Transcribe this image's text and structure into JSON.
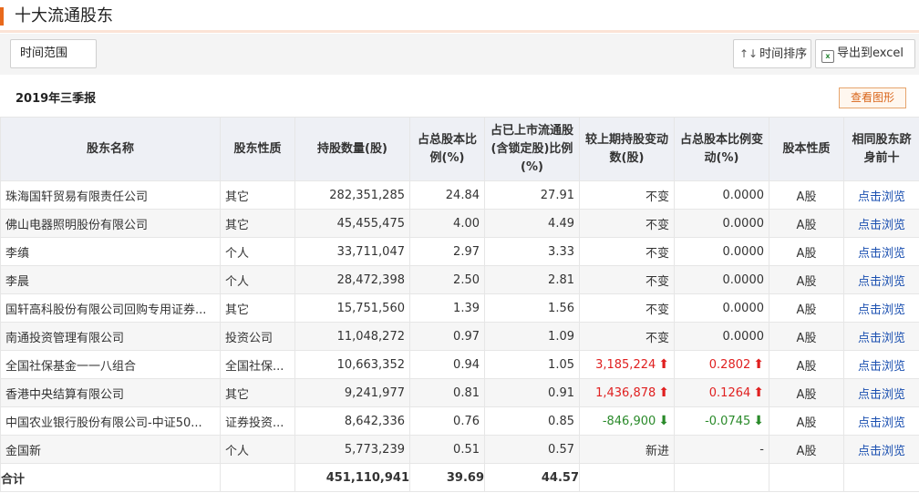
{
  "page_title": "十大流通股东",
  "filter": {
    "time_range_label": "时间范围"
  },
  "toolbar": {
    "sort_label": "时间排序",
    "export_label": "导出到excel"
  },
  "period": "2019年三季报",
  "view_chart_label": "查看图形",
  "columns": [
    "股东名称",
    "股东性质",
    "持股数量(股)",
    "占总股本比例(%)",
    "占已上市流通股(含锁定股)比例(%)",
    "较上期持股变动数(股)",
    "占总股本比例变动(%)",
    "股本性质",
    "相同股东跻身前十"
  ],
  "rows": [
    {
      "name": "珠海国轩贸易有限责任公司",
      "type": "其它",
      "shares": "282,351,285",
      "pct_total": "24.84",
      "pct_float": "27.91",
      "change": "不变",
      "change_dir": "none",
      "pct_change": "0.0000",
      "pct_change_dir": "none",
      "share_type": "A股",
      "link": "点击浏览"
    },
    {
      "name": "佛山电器照明股份有限公司",
      "type": "其它",
      "shares": "45,455,475",
      "pct_total": "4.00",
      "pct_float": "4.49",
      "change": "不变",
      "change_dir": "none",
      "pct_change": "0.0000",
      "pct_change_dir": "none",
      "share_type": "A股",
      "link": "点击浏览"
    },
    {
      "name": "李缜",
      "type": "个人",
      "shares": "33,711,047",
      "pct_total": "2.97",
      "pct_float": "3.33",
      "change": "不变",
      "change_dir": "none",
      "pct_change": "0.0000",
      "pct_change_dir": "none",
      "share_type": "A股",
      "link": "点击浏览"
    },
    {
      "name": "李晨",
      "type": "个人",
      "shares": "28,472,398",
      "pct_total": "2.50",
      "pct_float": "2.81",
      "change": "不变",
      "change_dir": "none",
      "pct_change": "0.0000",
      "pct_change_dir": "none",
      "share_type": "A股",
      "link": "点击浏览"
    },
    {
      "name": "国轩高科股份有限公司回购专用证券...",
      "type": "其它",
      "shares": "15,751,560",
      "pct_total": "1.39",
      "pct_float": "1.56",
      "change": "不变",
      "change_dir": "none",
      "pct_change": "0.0000",
      "pct_change_dir": "none",
      "share_type": "A股",
      "link": "点击浏览"
    },
    {
      "name": "南通投资管理有限公司",
      "type": "投资公司",
      "shares": "11,048,272",
      "pct_total": "0.97",
      "pct_float": "1.09",
      "change": "不变",
      "change_dir": "none",
      "pct_change": "0.0000",
      "pct_change_dir": "none",
      "share_type": "A股",
      "link": "点击浏览"
    },
    {
      "name": "全国社保基金一一八组合",
      "type": "全国社保...",
      "shares": "10,663,352",
      "pct_total": "0.94",
      "pct_float": "1.05",
      "change": "3,185,224",
      "change_dir": "up",
      "pct_change": "0.2802",
      "pct_change_dir": "up",
      "share_type": "A股",
      "link": "点击浏览"
    },
    {
      "name": "香港中央结算有限公司",
      "type": "其它",
      "shares": "9,241,977",
      "pct_total": "0.81",
      "pct_float": "0.91",
      "change": "1,436,878",
      "change_dir": "up",
      "pct_change": "0.1264",
      "pct_change_dir": "up",
      "share_type": "A股",
      "link": "点击浏览"
    },
    {
      "name": "中国农业银行股份有限公司-中证50...",
      "type": "证券投资...",
      "shares": "8,642,336",
      "pct_total": "0.76",
      "pct_float": "0.85",
      "change": "-846,900",
      "change_dir": "down",
      "pct_change": "-0.0745",
      "pct_change_dir": "down",
      "share_type": "A股",
      "link": "点击浏览"
    },
    {
      "name": "金国新",
      "type": "个人",
      "shares": "5,773,239",
      "pct_total": "0.51",
      "pct_float": "0.57",
      "change": "新进",
      "change_dir": "none",
      "pct_change": "-",
      "pct_change_dir": "none",
      "share_type": "A股",
      "link": "点击浏览"
    }
  ],
  "total": {
    "label": "合计",
    "shares": "451,110,941",
    "pct_total": "39.69",
    "pct_float": "44.57"
  },
  "colors": {
    "accent": "#e8691c",
    "up": "#e02020",
    "down": "#2a8a2a",
    "link": "#1a4fb0",
    "header_bg": "#eef0f5"
  }
}
